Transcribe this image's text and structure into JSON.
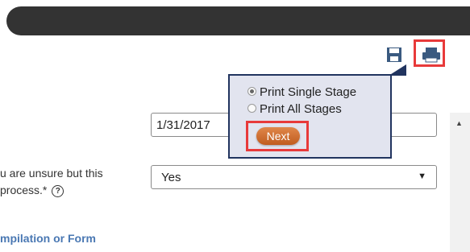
{
  "toolbar": {
    "save_icon": "save-icon",
    "print_icon": "print-icon"
  },
  "form": {
    "date_value": "1/31/2017",
    "question_text": "u are unsure but this process.*",
    "help_symbol": "?",
    "answer_value": "Yes",
    "answer_caret": "▼",
    "section_title": "mpilation or Form"
  },
  "print_popover": {
    "option_single": "Print Single Stage",
    "option_all": "Print All Stages",
    "selected": "Print Single Stage",
    "next_label": "Next"
  },
  "colors": {
    "topbar": "#333333",
    "popover_bg": "#e2e4ef",
    "popover_border": "#21345f",
    "highlight": "#e83a3a",
    "next_button": "#d0703a",
    "section_link": "#4a78b3"
  }
}
